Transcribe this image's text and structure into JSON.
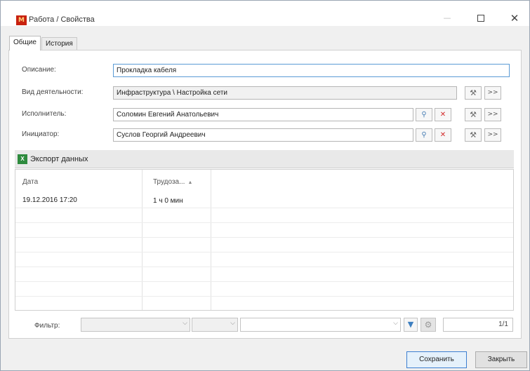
{
  "window": {
    "title": "Работа / Свойства",
    "app_icon_text": "М",
    "accent": "#c8210f"
  },
  "tabs": [
    {
      "label": "Общие",
      "active": true
    },
    {
      "label": "История",
      "active": false
    }
  ],
  "form": {
    "description_label": "Описание:",
    "description_value": "Прокладка кабеля",
    "activity_label": "Вид деятельности:",
    "activity_value": "Инфраструктура \\ Настройка сети",
    "executor_label": "Исполнитель:",
    "executor_value": "Соломин Евгений  Анатольевич",
    "initiator_label": "Инициатор:",
    "initiator_value": "Суслов Георгий Андреевич",
    "more_label": ">>"
  },
  "export": {
    "label": "Экспорт данных"
  },
  "grid": {
    "columns": [
      "Дата",
      "Трудоза..."
    ],
    "rows": [
      {
        "date": "19.12.2016 17:20",
        "effort": "1 ч 0 мин"
      }
    ]
  },
  "filter": {
    "label": "Фильтр:",
    "pager": "1/1"
  },
  "buttons": {
    "save": "Сохранить",
    "close": "Закрыть"
  },
  "icons": [
    "app-logo-icon",
    "minimize-icon",
    "maximize-icon",
    "close-icon",
    "search-icon",
    "clear-icon",
    "hammer-icon",
    "excel-icon",
    "sort-ascending-icon",
    "dropdown-arrow-icon",
    "funnel-icon",
    "gear-icon"
  ]
}
